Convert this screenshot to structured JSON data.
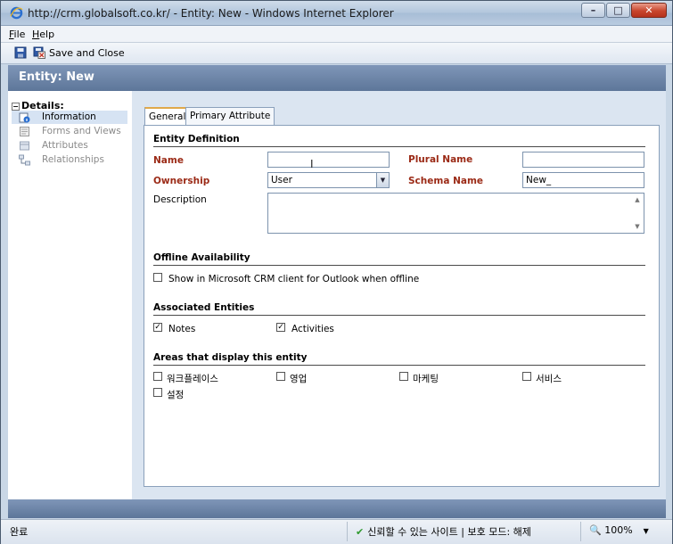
{
  "window": {
    "title": "http://crm.globalsoft.co.kr/ - Entity: New - Windows Internet Explorer",
    "minimize_glyph": "–",
    "maximize_glyph": "□",
    "close_glyph": "✕"
  },
  "menu": {
    "file_key": "F",
    "file_rest": "ile",
    "help_key": "H",
    "help_rest": "elp"
  },
  "toolbar": {
    "save_and_close": "Save and Close",
    "icons": [
      "save-icon",
      "save-close-icon"
    ]
  },
  "header": {
    "title": "Entity: New"
  },
  "nav": {
    "section": "Details:",
    "items": [
      {
        "label": "Information",
        "icon": "info-icon"
      },
      {
        "label": "Forms and Views",
        "icon": "forms-icon"
      },
      {
        "label": "Attributes",
        "icon": "attributes-icon"
      },
      {
        "label": "Relationships",
        "icon": "relationships-icon"
      }
    ]
  },
  "tabs": [
    {
      "label": "General"
    },
    {
      "label": "Primary Attribute"
    }
  ],
  "form": {
    "entity_definition": "Entity Definition",
    "name_label": "Name",
    "name_value": "",
    "plural_name_label": "Plural Name",
    "plural_name_value": "",
    "ownership_label": "Ownership",
    "ownership_value": "User",
    "schema_name_label": "Schema Name",
    "schema_name_value": "New_",
    "description_label": "Description",
    "offline_section": "Offline Availability",
    "offline_checkbox": "Show in Microsoft CRM client for Outlook when offline",
    "associated_section": "Associated Entities",
    "notes": "Notes",
    "activities": "Activities",
    "areas_section": "Areas that display this entity",
    "areas": [
      "워크플레이스",
      "영업",
      "마케팅",
      "서비스",
      "설정"
    ]
  },
  "status": {
    "left": "완료",
    "trust": "신뢰할 수 있는 사이트 | 보호 모드: 해제",
    "zoom": "100%"
  },
  "colors": {
    "header": "#6a83a8",
    "required_label": "#9b2a16",
    "tab_highlight": "#e0a84a",
    "trusted_check": "#2f9a2f"
  }
}
